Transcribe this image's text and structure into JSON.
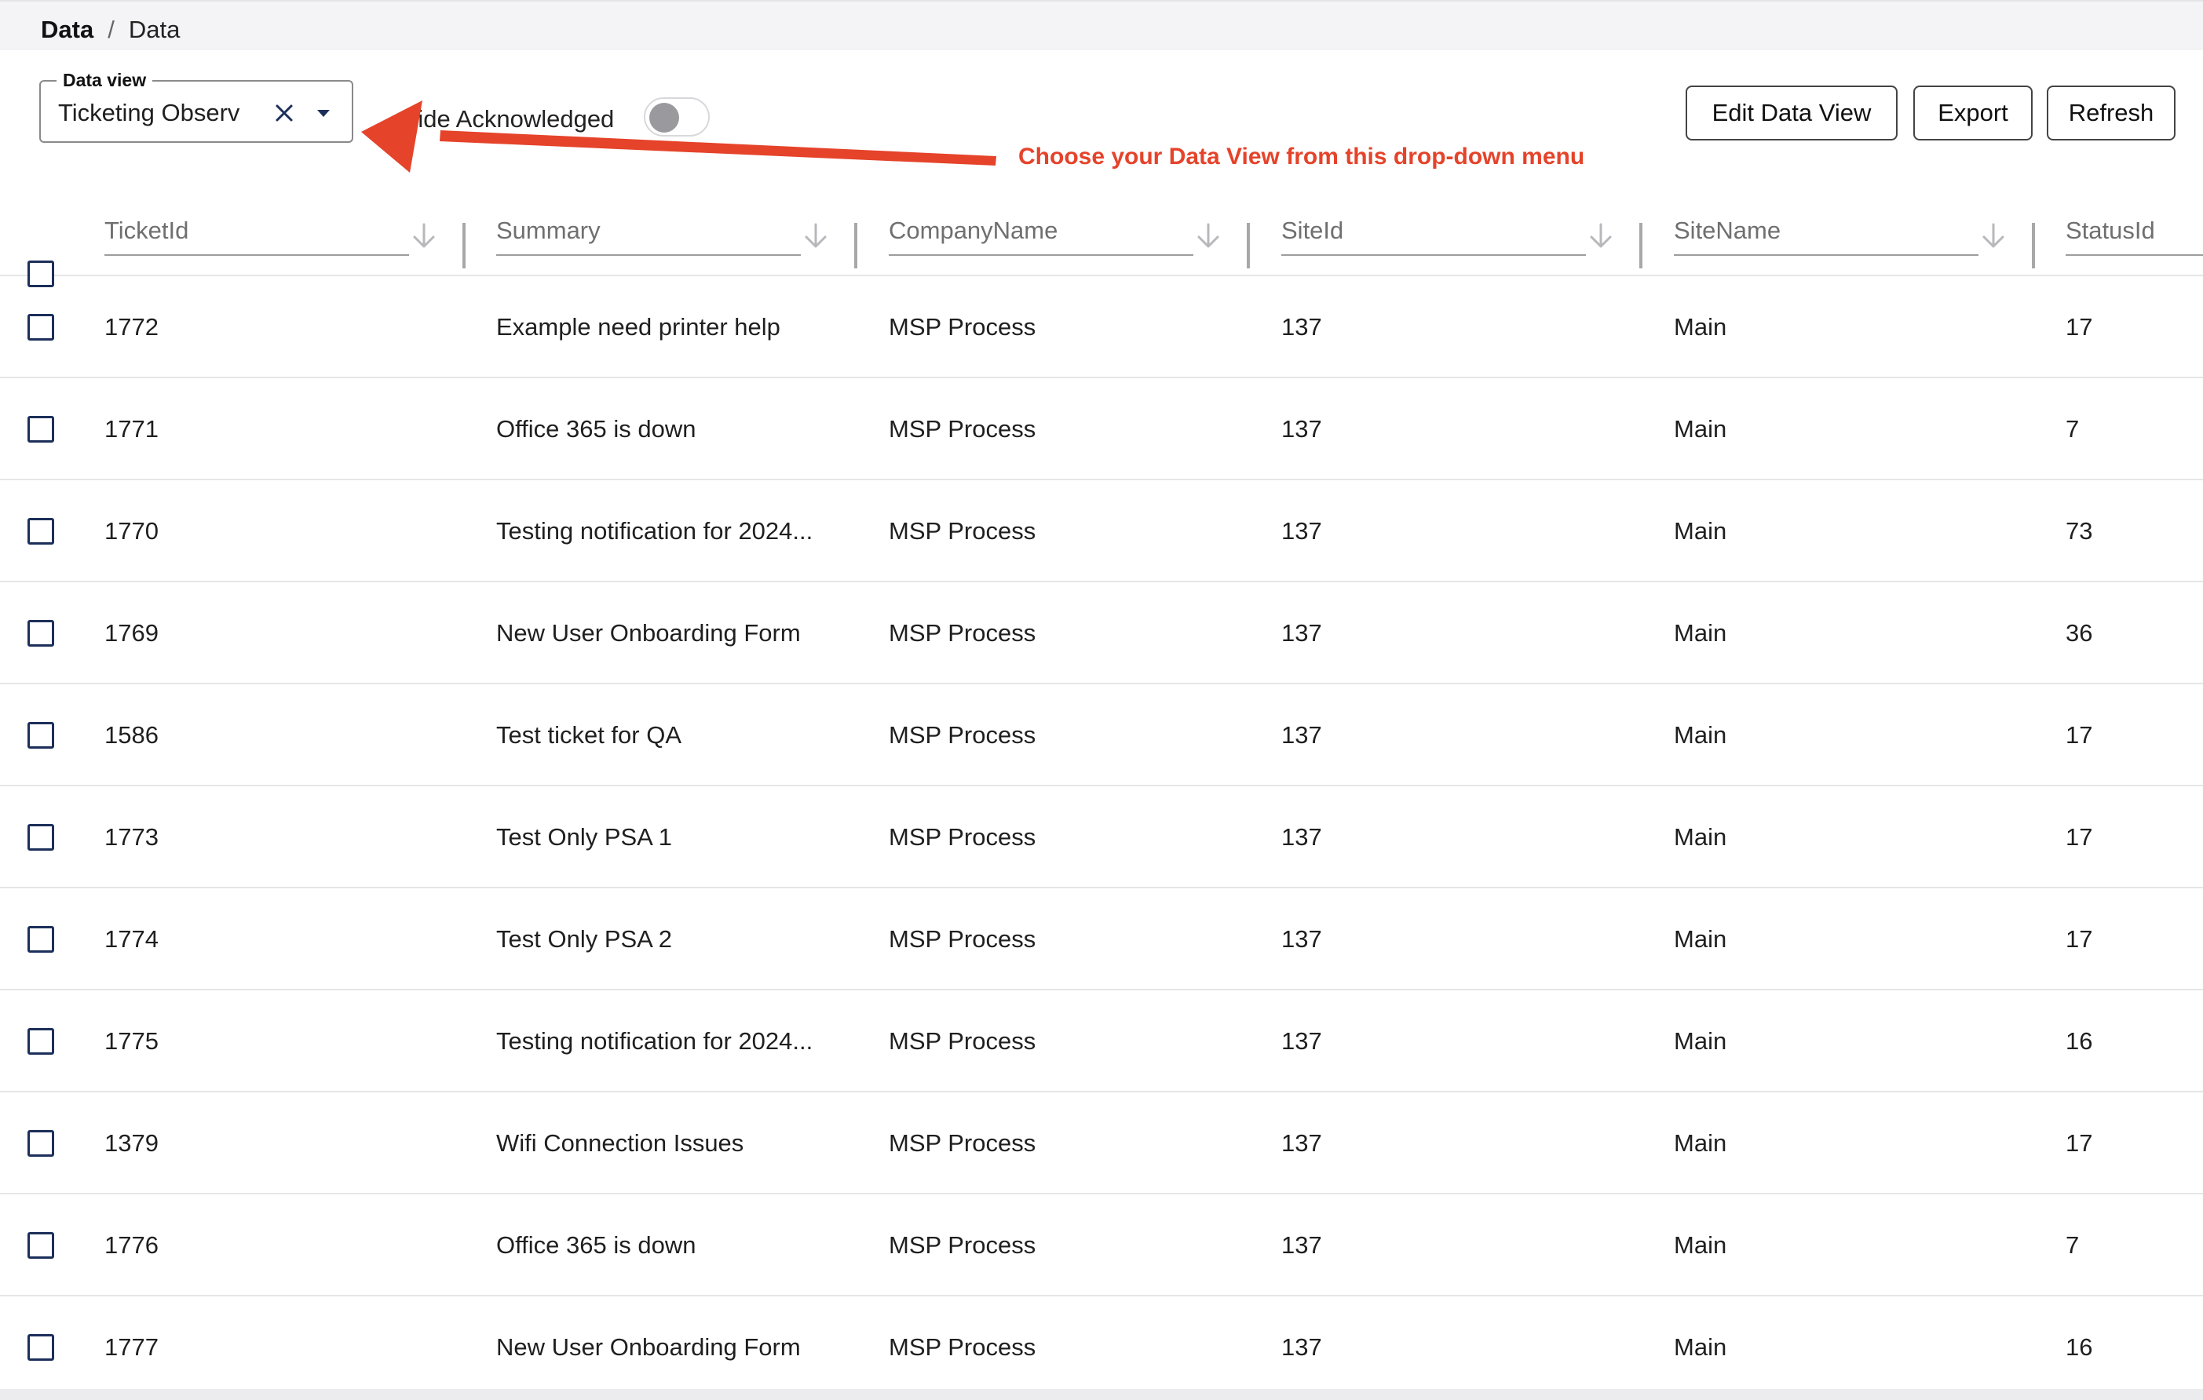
{
  "breadcrumb": {
    "root": "Data",
    "separator": "/",
    "current": "Data"
  },
  "data_view": {
    "legend": "Data view",
    "value": "Ticketing Observ",
    "clear_icon": "close-icon",
    "caret_icon": "caret-down-icon"
  },
  "hide_acknowledged": {
    "label": "Hide Acknowledged",
    "on": false
  },
  "annotation": {
    "text": "Choose your Data View from this drop-down menu",
    "color": "#e5432a"
  },
  "toolbar": {
    "edit_label": "Edit Data View",
    "export_label": "Export",
    "refresh_label": "Refresh"
  },
  "table": {
    "columns": [
      "TicketId",
      "Summary",
      "CompanyName",
      "SiteId",
      "SiteName",
      "StatusId"
    ],
    "rows": [
      [
        "1772",
        "Example need printer help",
        "MSP Process",
        "137",
        "Main",
        "17"
      ],
      [
        "1771",
        "Office 365 is down",
        "MSP Process",
        "137",
        "Main",
        "7"
      ],
      [
        "1770",
        "Testing notification for 2024...",
        "MSP Process",
        "137",
        "Main",
        "73"
      ],
      [
        "1769",
        "New User Onboarding Form",
        "MSP Process",
        "137",
        "Main",
        "36"
      ],
      [
        "1586",
        "Test ticket for QA",
        "MSP Process",
        "137",
        "Main",
        "17"
      ],
      [
        "1773",
        "Test Only PSA 1",
        "MSP Process",
        "137",
        "Main",
        "17"
      ],
      [
        "1774",
        "Test Only PSA 2",
        "MSP Process",
        "137",
        "Main",
        "17"
      ],
      [
        "1775",
        "Testing notification for 2024...",
        "MSP Process",
        "137",
        "Main",
        "16"
      ],
      [
        "1379",
        "Wifi Connection Issues",
        "MSP Process",
        "137",
        "Main",
        "17"
      ],
      [
        "1776",
        "Office 365 is down",
        "MSP Process",
        "137",
        "Main",
        "7"
      ],
      [
        "1777",
        "New User Onboarding Form",
        "MSP Process",
        "137",
        "Main",
        "16"
      ]
    ]
  },
  "colors": {
    "accent": "#1c2f5a",
    "annotation": "#e5432a",
    "border": "#e6e6e8"
  }
}
